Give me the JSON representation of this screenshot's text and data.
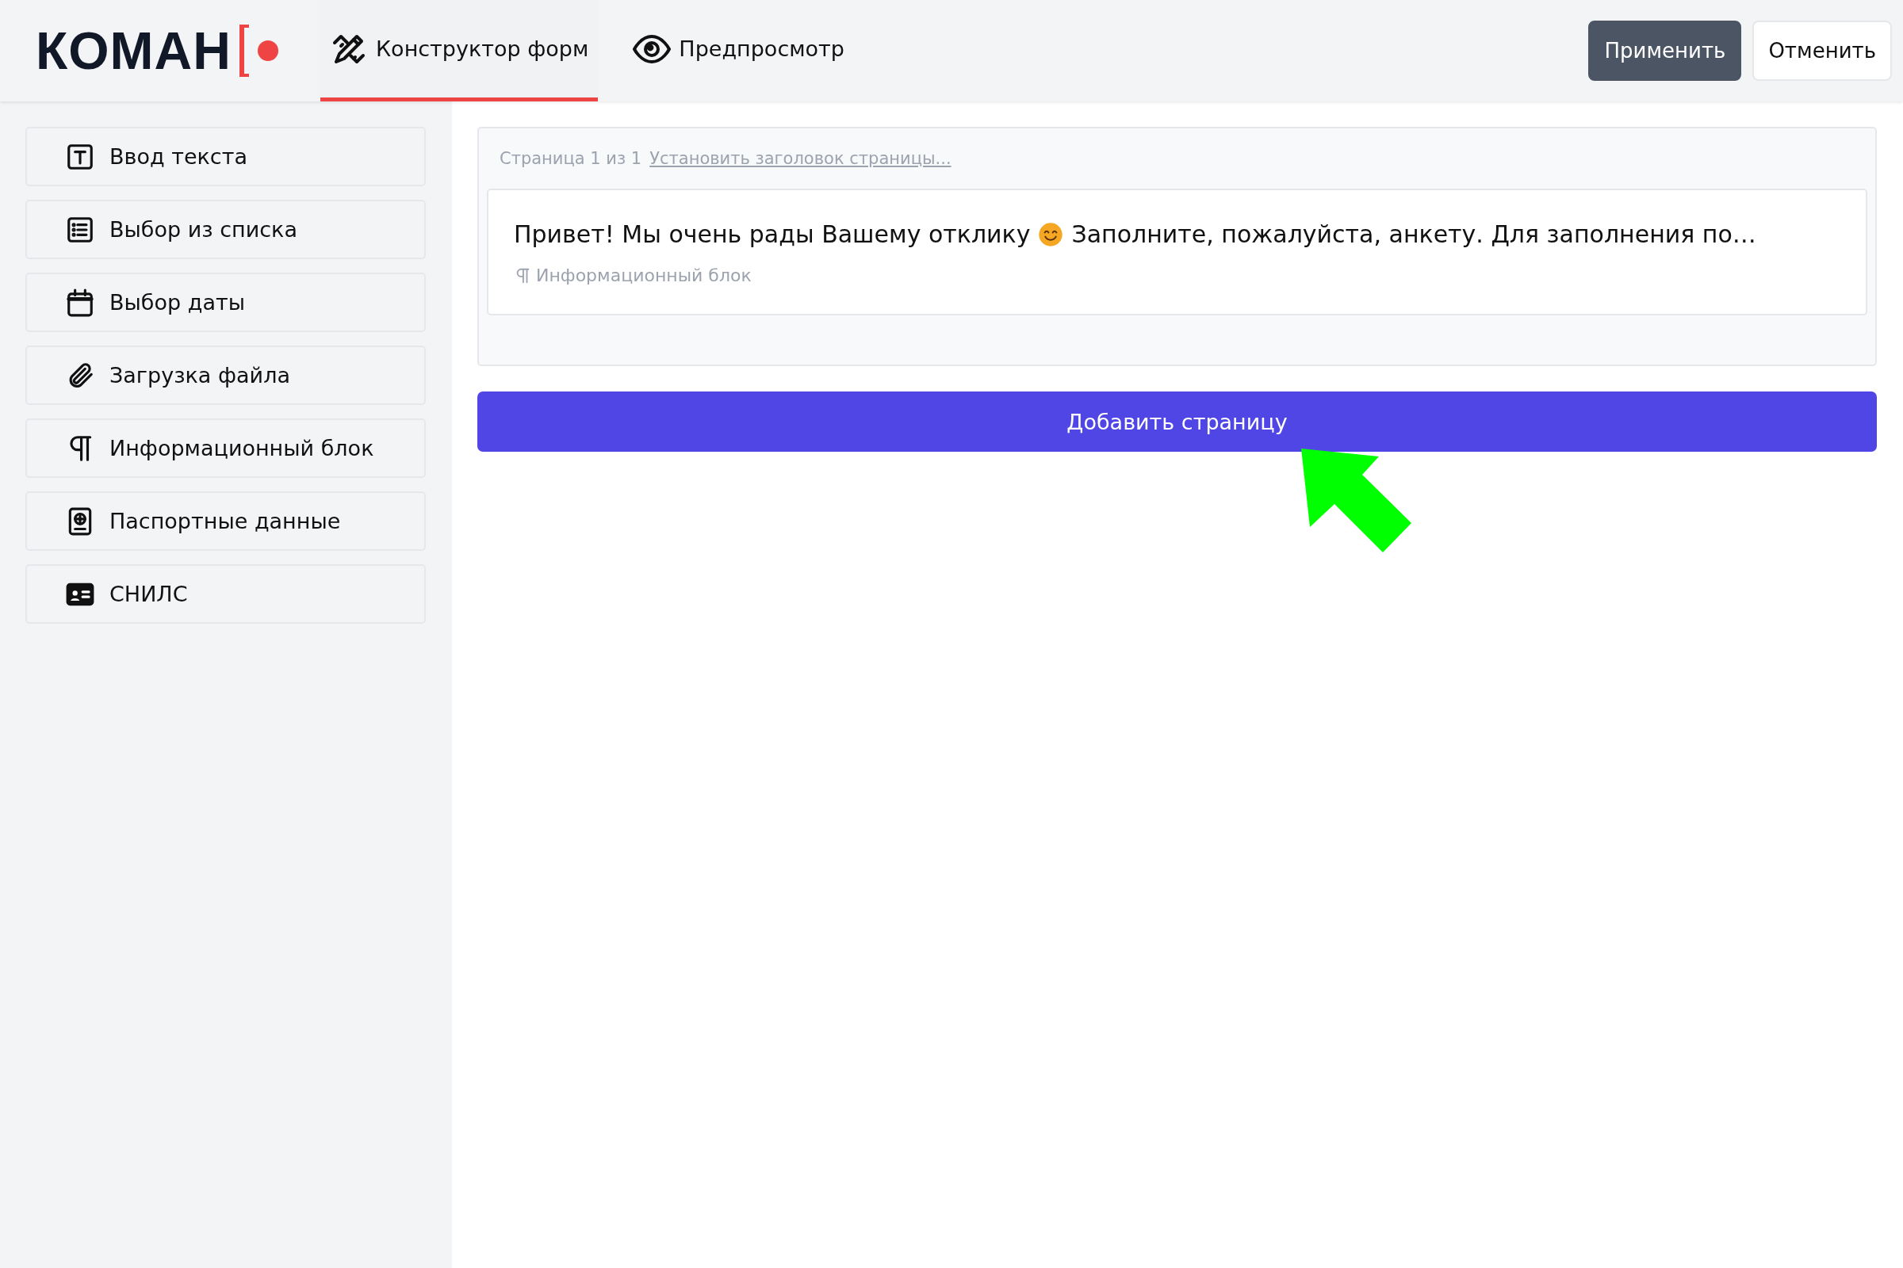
{
  "header": {
    "logo": "КОМАН",
    "tabs": [
      {
        "label": "Конструктор форм",
        "kind": "pencil-ruler",
        "selected": true
      },
      {
        "label": "Предпросмотр",
        "kind": "eye",
        "selected": false
      }
    ],
    "buttons": [
      {
        "label": "Применить",
        "kind": "primary"
      },
      {
        "label": "Отменить",
        "kind": "secondary"
      }
    ]
  },
  "sidebar": {
    "items": [
      {
        "label": "Ввод текста",
        "kind": "text"
      },
      {
        "label": "Выбор из списка",
        "kind": "list"
      },
      {
        "label": "Выбор даты",
        "kind": "calendar"
      },
      {
        "label": "Загрузка файла",
        "kind": "paperclip"
      },
      {
        "label": "Информационный блок",
        "kind": "pilcrow"
      },
      {
        "label": "Паспортные данные",
        "kind": "passport"
      },
      {
        "label": "СНИЛС",
        "kind": "id-card"
      }
    ]
  },
  "page": {
    "counter": "Страница 1 из 1",
    "title_link": "Установить заголовок страницы...",
    "blocks": [
      {
        "text_before_emoji": "Привет! Мы очень рады Вашему отклику",
        "text_after_emoji": "Заполните, пожалуйста, анкету. Для заполнения по…",
        "type_label": "Информационный блок"
      }
    ]
  },
  "add_page_button": "Добавить страницу"
}
